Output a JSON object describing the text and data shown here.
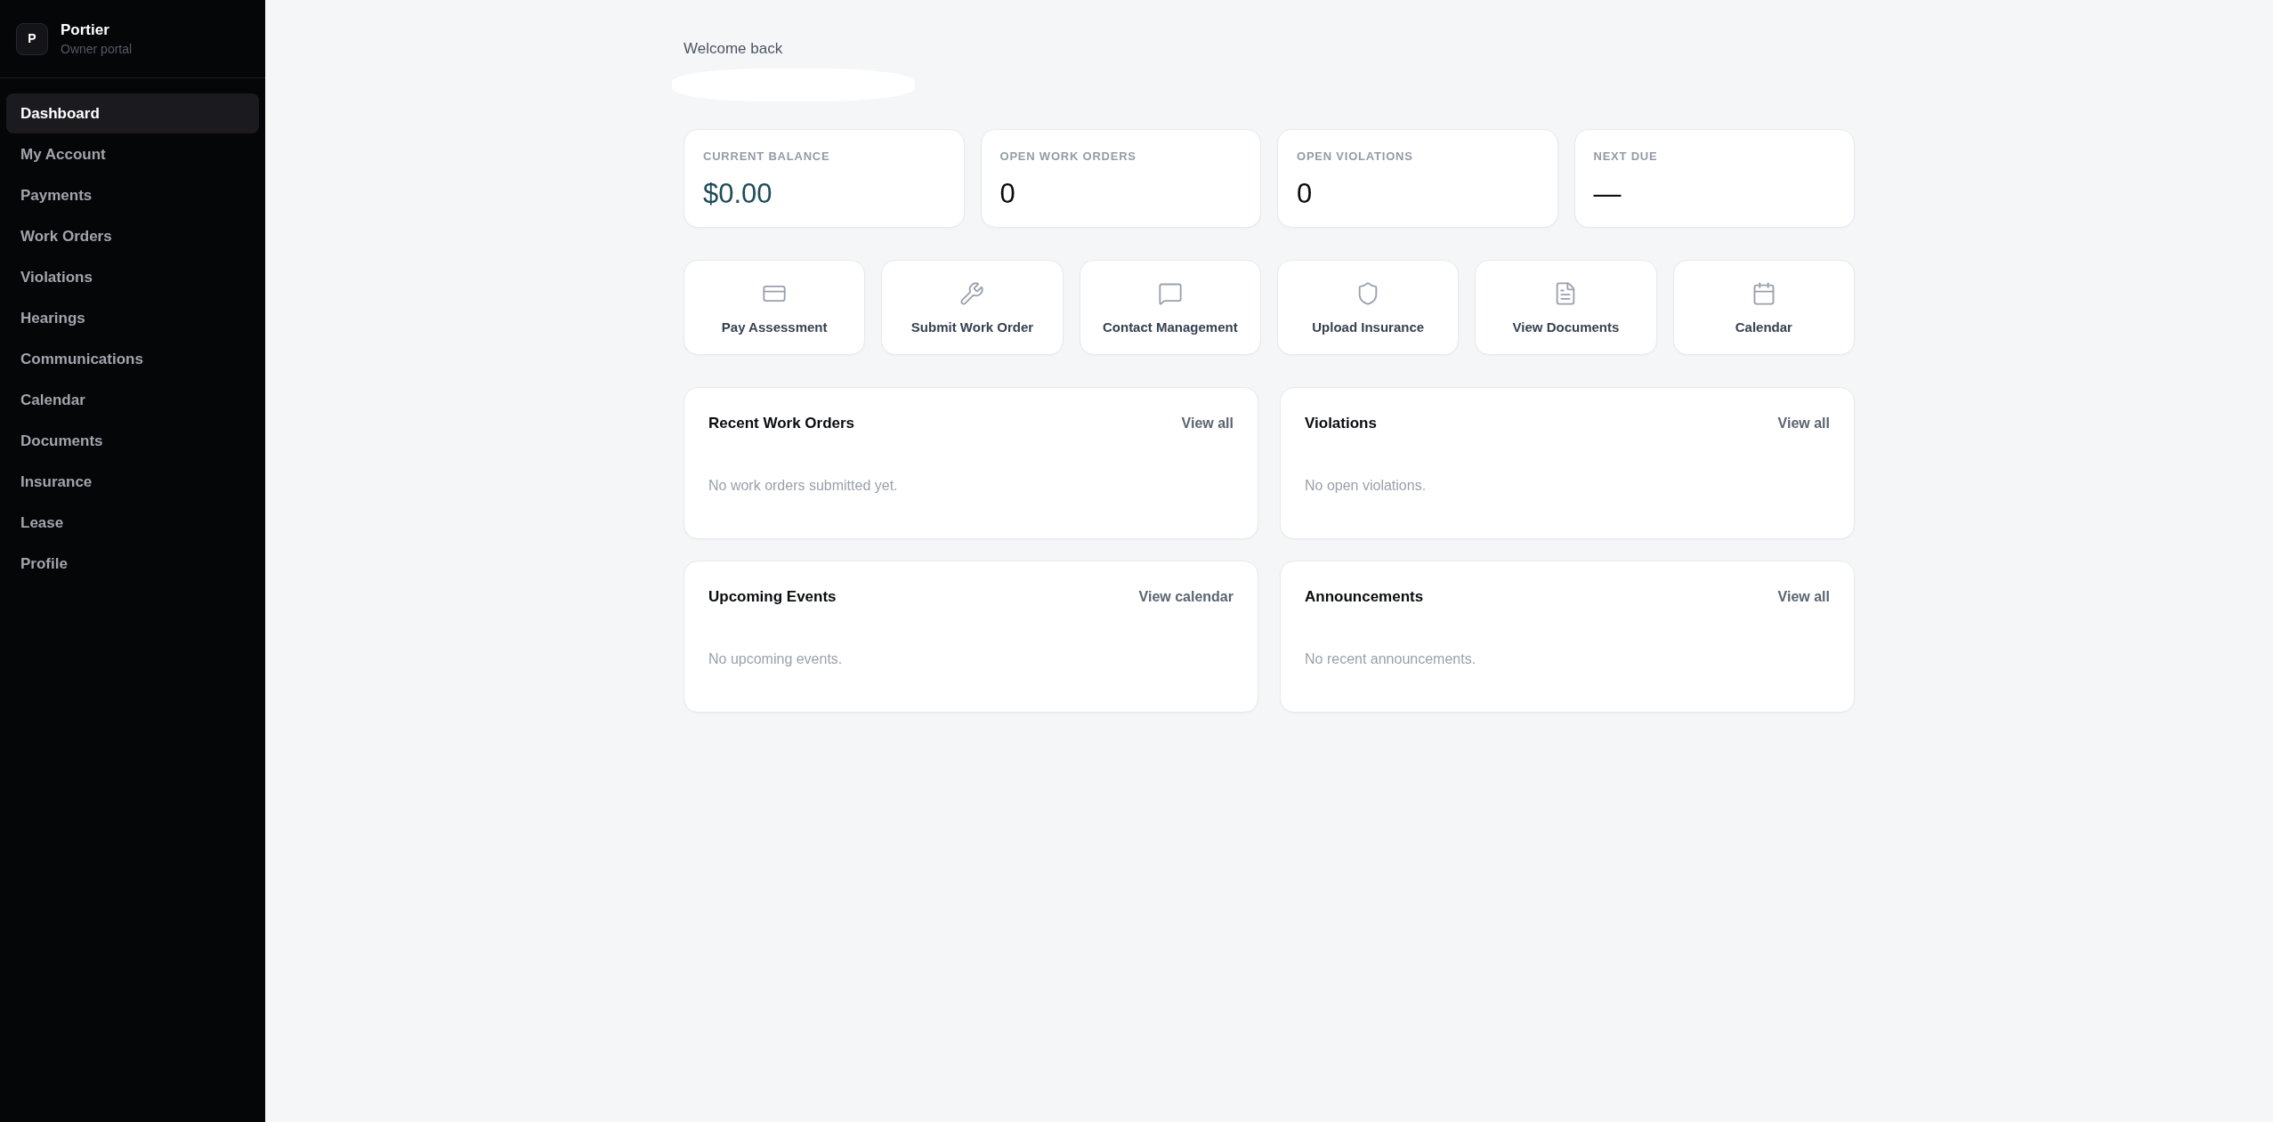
{
  "sidebar": {
    "brand": {
      "logo_letter": "P",
      "name": "Portier",
      "subtitle": "Owner portal"
    },
    "items": [
      {
        "label": "Dashboard",
        "selected": true
      },
      {
        "label": "My Account",
        "selected": false
      },
      {
        "label": "Payments",
        "selected": false
      },
      {
        "label": "Work Orders",
        "selected": false
      },
      {
        "label": "Violations",
        "selected": false
      },
      {
        "label": "Hearings",
        "selected": false
      },
      {
        "label": "Communications",
        "selected": false
      },
      {
        "label": "Calendar",
        "selected": false
      },
      {
        "label": "Documents",
        "selected": false
      },
      {
        "label": "Insurance",
        "selected": false
      },
      {
        "label": "Lease",
        "selected": false
      },
      {
        "label": "Profile",
        "selected": false
      }
    ]
  },
  "header": {
    "greeting": "Welcome back"
  },
  "stats": [
    {
      "label": "CURRENT BALANCE",
      "value": "$0.00",
      "kind": "money"
    },
    {
      "label": "OPEN WORK ORDERS",
      "value": "0",
      "kind": "count"
    },
    {
      "label": "OPEN VIOLATIONS",
      "value": "0",
      "kind": "count"
    },
    {
      "label": "NEXT DUE",
      "value": "—",
      "kind": "date"
    }
  ],
  "quick_actions": [
    {
      "label": "Pay Assessment",
      "kind": "payment"
    },
    {
      "label": "Submit Work Order",
      "kind": "work_order"
    },
    {
      "label": "Contact Management",
      "kind": "message"
    },
    {
      "label": "Upload Insurance",
      "kind": "insurance"
    },
    {
      "label": "View Documents",
      "kind": "documents"
    },
    {
      "label": "Calendar",
      "kind": "calendar"
    }
  ],
  "panels": [
    {
      "title": "Recent Work Orders",
      "link": "View all",
      "empty_text": "No work orders submitted yet."
    },
    {
      "title": "Violations",
      "link": "View all",
      "empty_text": "No open violations."
    },
    {
      "title": "Upcoming Events",
      "link": "View calendar",
      "empty_text": "No upcoming events."
    },
    {
      "title": "Announcements",
      "link": "View all",
      "empty_text": "No recent announcements."
    }
  ]
}
